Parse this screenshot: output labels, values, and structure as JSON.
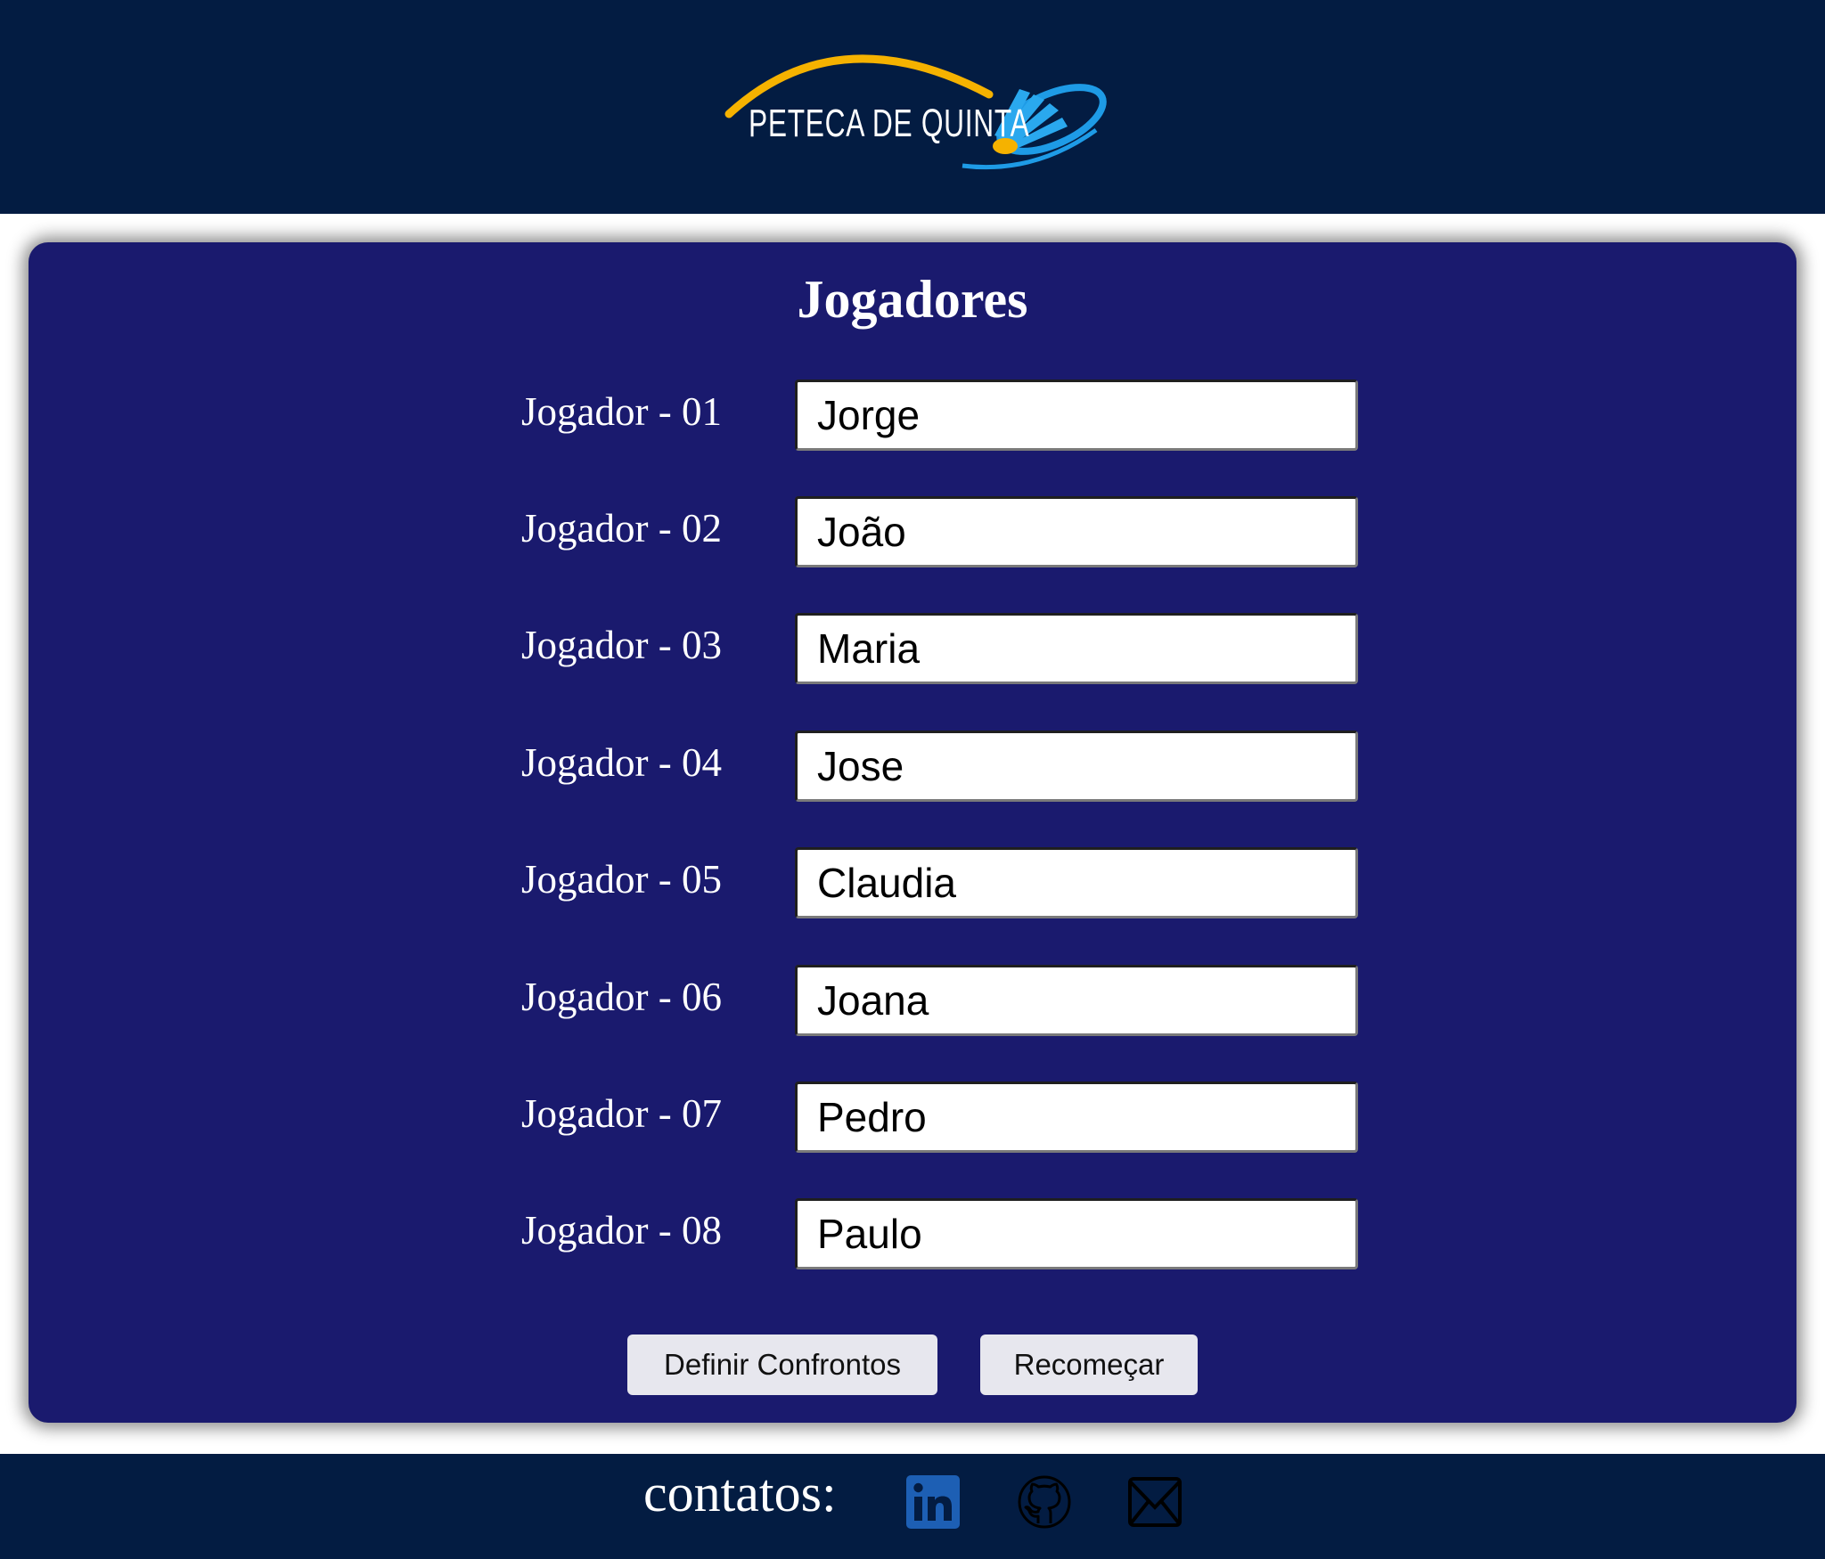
{
  "header": {
    "logo_text": "PETECA DE QUINTA"
  },
  "players_card": {
    "title": "Jogadores",
    "players": [
      {
        "label": "Jogador - 01",
        "value": "Jorge"
      },
      {
        "label": "Jogador - 02",
        "value": "João"
      },
      {
        "label": "Jogador - 03",
        "value": "Maria"
      },
      {
        "label": "Jogador - 04",
        "value": "Jose"
      },
      {
        "label": "Jogador - 05",
        "value": "Claudia"
      },
      {
        "label": "Jogador - 06",
        "value": "Joana"
      },
      {
        "label": "Jogador - 07",
        "value": "Pedro"
      },
      {
        "label": "Jogador - 08",
        "value": "Paulo"
      }
    ],
    "define_button_label": "Definir Confrontos",
    "restart_button_label": "Recomeçar"
  },
  "footer": {
    "contacts_label": "contatos:",
    "icons": [
      "linkedin-icon",
      "github-icon",
      "email-icon"
    ]
  },
  "colors": {
    "header_bg": "#031c42",
    "card_bg": "#1a1a6e",
    "logo_arc": "#f5b200",
    "logo_shuttle": "#1e9be6",
    "linkedin": "#1d5fb4"
  }
}
